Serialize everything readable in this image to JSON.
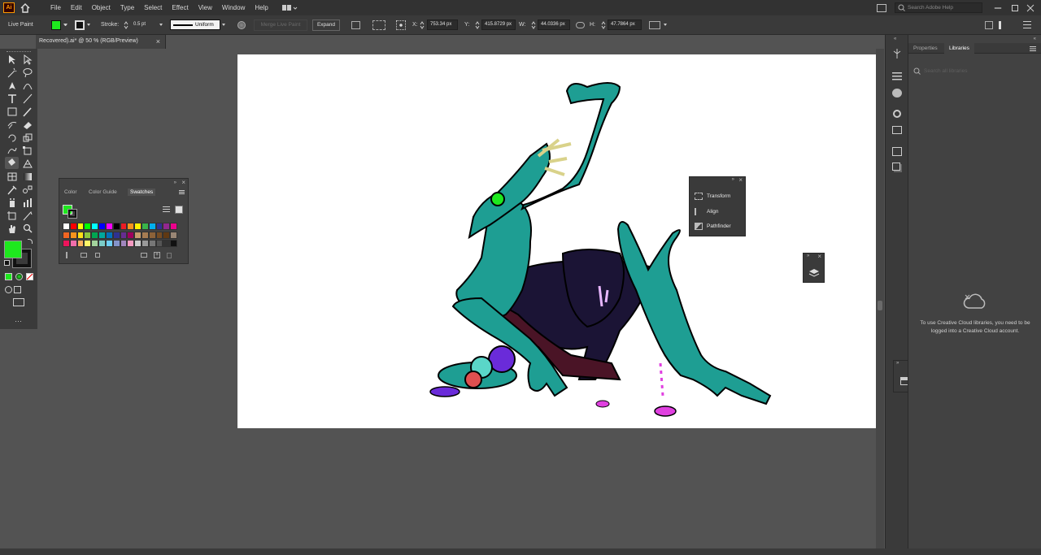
{
  "app": {
    "logo": "Ai"
  },
  "menu": [
    "File",
    "Edit",
    "Object",
    "Type",
    "Select",
    "Effect",
    "View",
    "Window",
    "Help"
  ],
  "search": {
    "placeholder": "Search Adobe Help"
  },
  "control": {
    "mode": "Live Paint",
    "stroke_label": "Stroke:",
    "stroke_weight": "0.5 pt",
    "profile": "Uniform",
    "merge_button": "Merge Live Paint",
    "expand_button": "Expand",
    "x_label": "X:",
    "x_value": "753.34 px",
    "y_label": "Y:",
    "y_value": "415.8729 px",
    "w_label": "W:",
    "w_value": "44.0336 px",
    "h_label": "H:",
    "h_value": "47.7864 px"
  },
  "document_tab": {
    "title": "Recovered).ai* @ 50 % (RGB/Preview)"
  },
  "swatches_panel": {
    "tabs": [
      "Color",
      "Color Guide",
      "Swatches"
    ],
    "active_tab": "Swatches"
  },
  "float_panel": {
    "items": [
      "Transform",
      "Align",
      "Pathfinder"
    ]
  },
  "right_panel": {
    "tabs": [
      "Properties",
      "Libraries"
    ],
    "active_tab": "Libraries",
    "search_placeholder": "Search all libraries",
    "message": "To use Creative Cloud libraries, you need to be logged into a Creative Cloud account."
  },
  "colors": {
    "fill": "#1ee81e",
    "teal": "#1e9e93",
    "ui_bg": "#535353"
  }
}
